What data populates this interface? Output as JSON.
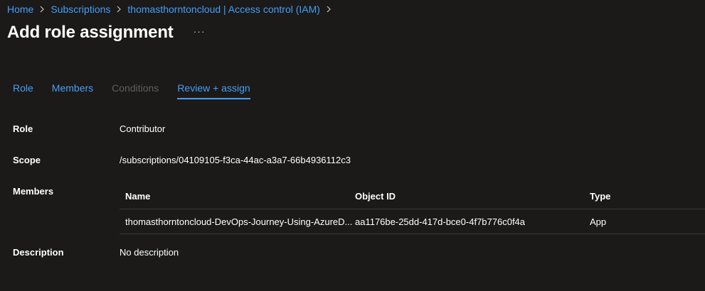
{
  "breadcrumb": {
    "items": [
      "Home",
      "Subscriptions",
      "thomasthorntoncloud | Access control (IAM)"
    ]
  },
  "header": {
    "title": "Add role assignment",
    "more_label": "···"
  },
  "tabs": [
    {
      "label": "Role",
      "state": "enabled"
    },
    {
      "label": "Members",
      "state": "enabled"
    },
    {
      "label": "Conditions",
      "state": "disabled"
    },
    {
      "label": "Review + assign",
      "state": "active"
    }
  ],
  "review": {
    "role_label": "Role",
    "role_value": "Contributor",
    "scope_label": "Scope",
    "scope_value": "/subscriptions/04109105-f3ca-44ac-a3a7-66b4936112c3",
    "members_label": "Members",
    "description_label": "Description",
    "description_value": "No description"
  },
  "members_table": {
    "columns": [
      "Name",
      "Object ID",
      "Type"
    ],
    "rows": [
      {
        "name": "thomasthorntoncloud-DevOps-Journey-Using-AzureD...",
        "object_id": "aa1176be-25dd-417d-bce0-4f7b776c0f4a",
        "type": "App"
      }
    ]
  },
  "colors": {
    "background": "#1b1a19",
    "link": "#479ef5",
    "disabled": "#605e5c",
    "divider": "#3b3a39"
  },
  "icons": {
    "breadcrumb_separator": "chevron-right-icon"
  }
}
